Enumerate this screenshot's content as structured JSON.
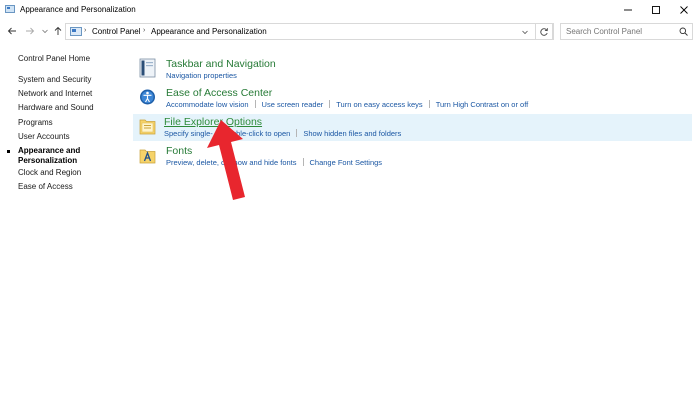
{
  "window": {
    "title": "Appearance and Personalization"
  },
  "address": {
    "crumbs": [
      "Control Panel",
      "Appearance and Personalization"
    ],
    "search_placeholder": "Search Control Panel"
  },
  "leftnav": {
    "home": "Control Panel Home",
    "items": [
      "System and Security",
      "Network and Internet",
      "Hardware and Sound",
      "Programs",
      "User Accounts"
    ],
    "active": "Appearance and Personalization",
    "items_after": [
      "Clock and Region",
      "Ease of Access"
    ]
  },
  "categories": [
    {
      "title": "Taskbar and Navigation",
      "icon": "taskbar-icon",
      "links": [
        "Navigation properties"
      ]
    },
    {
      "title": "Ease of Access Center",
      "icon": "ease-of-access-icon",
      "links": [
        "Accommodate low vision",
        "Use screen reader",
        "Turn on easy access keys",
        "Turn High Contrast on or off"
      ]
    },
    {
      "title": "File Explorer Options",
      "icon": "folder-options-icon",
      "links": [
        "Specify single- or double-click to open",
        "Show hidden files and folders"
      ]
    },
    {
      "title": "Fonts",
      "icon": "fonts-icon",
      "links": [
        "Preview, delete, or show and hide fonts",
        "Change Font Settings"
      ]
    }
  ],
  "colors": {
    "category_title": "#267a36",
    "link": "#1b57a3",
    "highlight": "#e5f3fb",
    "annotation_arrow": "#e8262e"
  }
}
